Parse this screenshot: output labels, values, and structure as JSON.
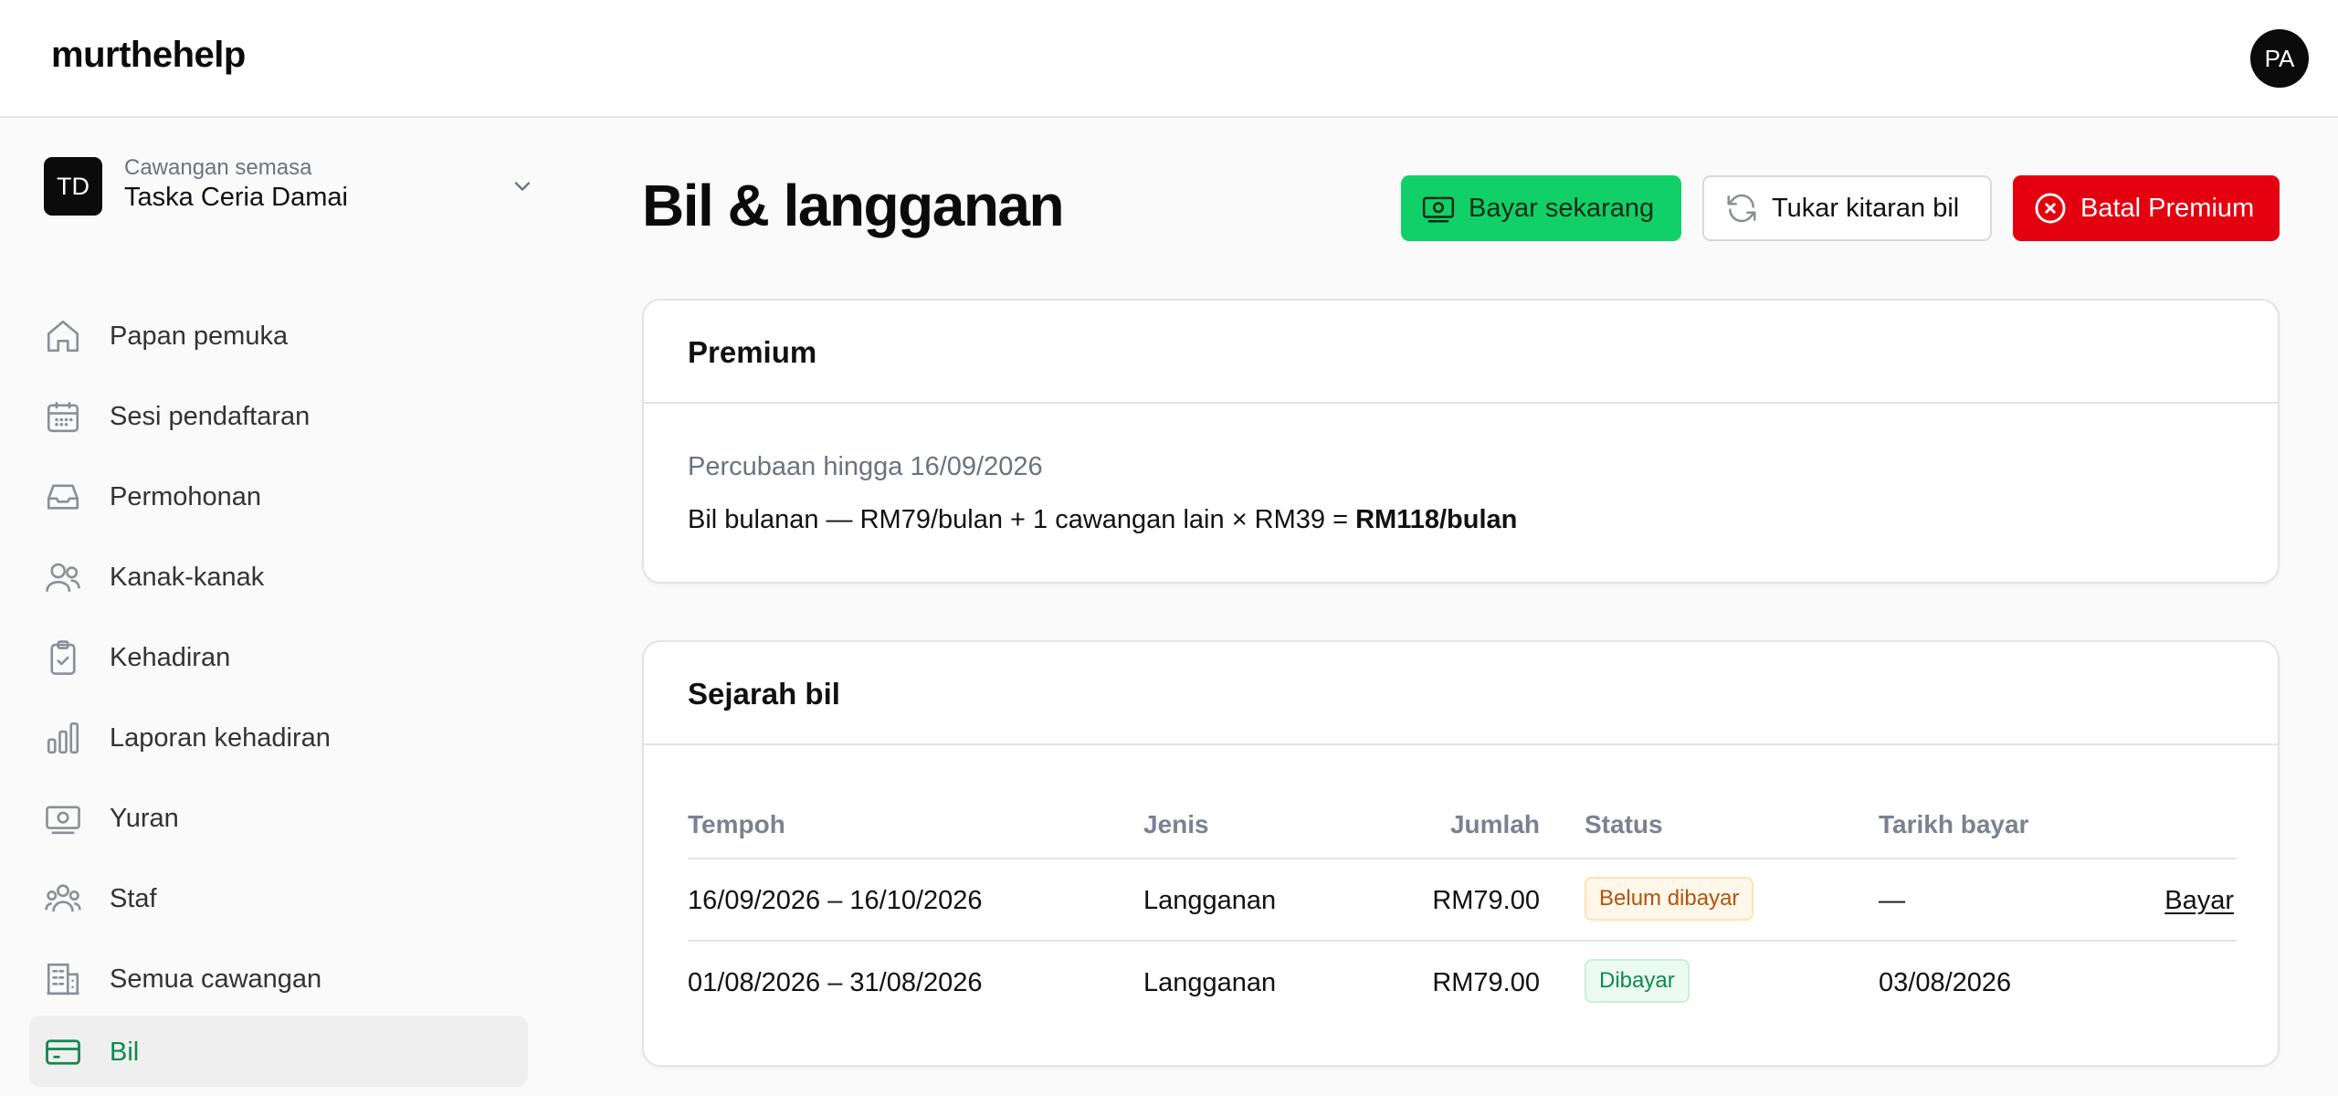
{
  "header": {
    "brand": "murthehelp",
    "avatar_initials": "PA"
  },
  "sidebar": {
    "branch": {
      "initials": "TD",
      "caption": "Cawangan semasa",
      "name": "Taska Ceria Damai"
    },
    "items": [
      {
        "label": "Papan pemuka",
        "icon": "home-icon"
      },
      {
        "label": "Sesi pendaftaran",
        "icon": "calendar-icon"
      },
      {
        "label": "Permohonan",
        "icon": "inbox-icon"
      },
      {
        "label": "Kanak-kanak",
        "icon": "users-icon"
      },
      {
        "label": "Kehadiran",
        "icon": "clipboard-check-icon"
      },
      {
        "label": "Laporan kehadiran",
        "icon": "bar-chart-icon"
      },
      {
        "label": "Yuran",
        "icon": "banknote-icon"
      },
      {
        "label": "Staf",
        "icon": "group-icon"
      },
      {
        "label": "Semua cawangan",
        "icon": "building-icon"
      },
      {
        "label": "Bil",
        "icon": "credit-card-icon",
        "active": true
      }
    ]
  },
  "main": {
    "title": "Bil & langganan",
    "actions": {
      "pay_now": "Bayar sekarang",
      "change_cycle": "Tukar kitaran bil",
      "cancel_premium": "Batal Premium"
    },
    "premium": {
      "title": "Premium",
      "trial": "Percubaan hingga 16/09/2026",
      "monthly_prefix": "Bil bulanan — RM79/bulan + 1 cawangan lain × RM39 = ",
      "monthly_total": "RM118/bulan"
    },
    "history": {
      "title": "Sejarah bil",
      "columns": [
        "Tempoh",
        "Jenis",
        "Jumlah",
        "Status",
        "Tarikh bayar"
      ],
      "rows": [
        {
          "period": "16/09/2026 – 16/10/2026",
          "type": "Langganan",
          "amount": "RM79.00",
          "status": "Belum dibayar",
          "paid_date": "—",
          "action": "Bayar"
        },
        {
          "period": "01/08/2026 – 31/08/2026",
          "type": "Langganan",
          "amount": "RM79.00",
          "status": "Dibayar",
          "paid_date": "03/08/2026",
          "action": ""
        }
      ]
    }
  },
  "colors": {
    "accent_green": "#12d068",
    "danger_red": "#e4000f",
    "active_nav": "#0e8a4b"
  }
}
